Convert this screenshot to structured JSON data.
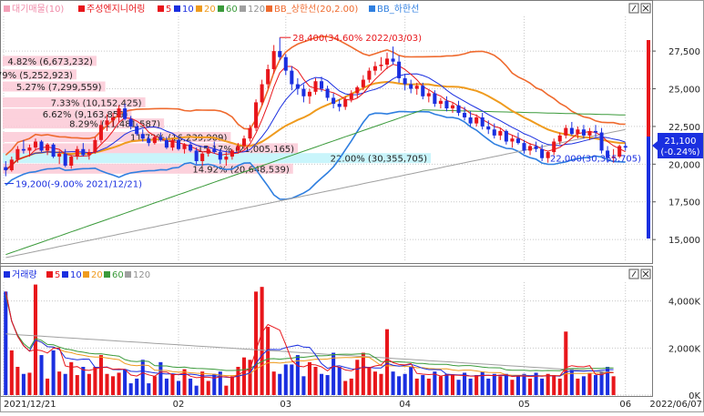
{
  "price_legend": {
    "item_avg_volume": "대기매물(10)",
    "item_name": "주성엔지니어링",
    "ma": [
      "5",
      "10",
      "20",
      "60",
      "120"
    ],
    "item_bb_upper": "BB_상한선(20,2.00)",
    "item_bb_lower": "BB_하한선"
  },
  "volume_legend": {
    "item_volume": "거래량",
    "ma": [
      "5",
      "10",
      "20",
      "60",
      "120"
    ]
  },
  "colors": {
    "up": "#e8161b",
    "down": "#1a2fe0",
    "ma5": "#e8161b",
    "ma10": "#1a2fe0",
    "ma20": "#ef9b1e",
    "ma60": "#3a9a3a",
    "ma120": "#a0a0a0",
    "bb_upper": "#ef6a2e",
    "bb_lower": "#2f7fe0",
    "zone_pink": "#fbc9d6",
    "zone_cyan": "#bff3fa"
  },
  "chart_data": [
    {
      "type": "candlestick",
      "title": "",
      "x_dates": [
        "2021/12/21",
        "2022/06/07"
      ],
      "x_tick_labels": [
        "2021/12/21",
        "02",
        "03",
        "04",
        "05",
        "06",
        "2022/06/07"
      ],
      "ylim": [
        13500,
        29800
      ],
      "y_ticks": [
        "27,500",
        "25,000",
        "22,500",
        "20,000",
        "17,500",
        "15,000"
      ],
      "annotations": {
        "high": "28,400(34.60% 2022/03/03)",
        "low": "19,200(-9.00% 2021/12/21)",
        "last": "22,000(30,355,705)"
      },
      "current_price": "21,100",
      "current_change": "(-0.24%)",
      "volume_profile": [
        {
          "label": "4.82% (6,673,232)",
          "price": 26850,
          "pct": 4.82
        },
        {
          "label": "3.79% (5,252,923)",
          "price": 25950,
          "pct": 3.79
        },
        {
          "label": "5.27% (7,299,559)",
          "price": 25150,
          "pct": 5.27
        },
        {
          "label": "7.33% (10,152,425)",
          "price": 24100,
          "pct": 7.33
        },
        {
          "label": "6.62% (9,163,859)",
          "price": 23350,
          "pct": 6.62
        },
        {
          "label": "8.29% (11,481,587)",
          "price": 22700,
          "pct": 8.29
        },
        {
          "label": "11.72% (16,239,909)",
          "price": 21800,
          "pct": 11.72
        },
        {
          "label": "15.17% (21,005,165)",
          "price": 21050,
          "pct": 15.17
        },
        {
          "label": "22.00% (30,355,705)",
          "price": 20400,
          "pct": 22.0
        },
        {
          "label": "14.92% (20,648,539)",
          "price": 19700,
          "pct": 14.92
        }
      ],
      "candles": [
        [
          19800,
          20200,
          19200,
          19600
        ],
        [
          19600,
          20500,
          19500,
          20300
        ],
        [
          20300,
          21200,
          20100,
          21000
        ],
        [
          21000,
          21600,
          20700,
          20900
        ],
        [
          20900,
          21300,
          20500,
          21100
        ],
        [
          21100,
          21700,
          20900,
          21500
        ],
        [
          21500,
          21600,
          20800,
          20900
        ],
        [
          20900,
          21400,
          20600,
          21300
        ],
        [
          21300,
          21400,
          20400,
          20500
        ],
        [
          20500,
          20900,
          20000,
          20700
        ],
        [
          20700,
          21000,
          19800,
          19900
        ],
        [
          19900,
          20600,
          19700,
          20500
        ],
        [
          20500,
          21200,
          20300,
          21000
        ],
        [
          21000,
          21400,
          20500,
          20600
        ],
        [
          20600,
          21000,
          20300,
          20800
        ],
        [
          20800,
          21800,
          20700,
          21600
        ],
        [
          21600,
          22900,
          21400,
          22600
        ],
        [
          22600,
          23300,
          22200,
          22900
        ],
        [
          22900,
          23400,
          22500,
          23100
        ],
        [
          23100,
          23900,
          22800,
          23700
        ],
        [
          23700,
          24000,
          22900,
          23000
        ],
        [
          23000,
          23200,
          22300,
          22500
        ],
        [
          22500,
          22700,
          21900,
          22000
        ],
        [
          22000,
          22300,
          21500,
          21700
        ],
        [
          21700,
          21900,
          21200,
          21400
        ],
        [
          21400,
          21900,
          21300,
          21800
        ],
        [
          21800,
          22100,
          21500,
          21600
        ],
        [
          21600,
          21800,
          21000,
          21100
        ],
        [
          21100,
          21700,
          20900,
          21600
        ],
        [
          21600,
          21700,
          20900,
          21000
        ],
        [
          21000,
          21400,
          20700,
          21300
        ],
        [
          21300,
          21500,
          20800,
          20900
        ],
        [
          20900,
          21100,
          20000,
          20200
        ],
        [
          20200,
          20800,
          19900,
          20700
        ],
        [
          20700,
          21200,
          20500,
          21000
        ],
        [
          21000,
          21500,
          20700,
          20800
        ],
        [
          20800,
          21000,
          20000,
          20300
        ],
        [
          20300,
          20800,
          19900,
          20500
        ],
        [
          20500,
          21000,
          20300,
          20900
        ],
        [
          20900,
          21400,
          20700,
          21200
        ],
        [
          21200,
          21900,
          21000,
          21700
        ],
        [
          21700,
          22600,
          21500,
          22400
        ],
        [
          22400,
          24300,
          22200,
          24100
        ],
        [
          24100,
          25600,
          23900,
          25300
        ],
        [
          25300,
          26600,
          25000,
          26300
        ],
        [
          26300,
          27900,
          26000,
          27500
        ],
        [
          27500,
          28400,
          26900,
          27100
        ],
        [
          27100,
          27300,
          25900,
          26200
        ],
        [
          26200,
          26500,
          24900,
          25300
        ],
        [
          25300,
          25700,
          24600,
          25000
        ],
        [
          25000,
          25300,
          24100,
          24500
        ],
        [
          24500,
          25000,
          24000,
          24800
        ],
        [
          24800,
          25700,
          24600,
          25500
        ],
        [
          25500,
          25800,
          24800,
          25000
        ],
        [
          25000,
          25200,
          24200,
          24400
        ],
        [
          24400,
          24700,
          23700,
          24000
        ],
        [
          24000,
          24300,
          23500,
          23800
        ],
        [
          23800,
          24500,
          23600,
          24300
        ],
        [
          24300,
          24900,
          24100,
          24700
        ],
        [
          24700,
          25200,
          24400,
          25100
        ],
        [
          25100,
          25900,
          24900,
          25600
        ],
        [
          25600,
          26400,
          25400,
          26200
        ],
        [
          26200,
          26800,
          25900,
          26500
        ],
        [
          26500,
          27100,
          26200,
          26600
        ],
        [
          26600,
          27400,
          26300,
          27000
        ],
        [
          27000,
          27800,
          26600,
          26800
        ],
        [
          26800,
          27200,
          25400,
          25700
        ],
        [
          25700,
          26000,
          24900,
          25300
        ],
        [
          25300,
          25600,
          24700,
          25000
        ],
        [
          25000,
          25400,
          24600,
          25200
        ],
        [
          25200,
          25400,
          24300,
          24500
        ],
        [
          24500,
          24900,
          24100,
          24700
        ],
        [
          24700,
          24900,
          23800,
          24000
        ],
        [
          24000,
          24400,
          23700,
          24200
        ],
        [
          24200,
          24500,
          23500,
          23700
        ],
        [
          23700,
          24100,
          23400,
          23900
        ],
        [
          23900,
          24200,
          23200,
          23400
        ],
        [
          23400,
          23800,
          22900,
          23100
        ],
        [
          23100,
          23500,
          22500,
          22700
        ],
        [
          22700,
          23300,
          22500,
          23100
        ],
        [
          23100,
          23400,
          22300,
          22500
        ],
        [
          22500,
          22900,
          22000,
          22300
        ],
        [
          22300,
          22700,
          21700,
          21900
        ],
        [
          21900,
          22400,
          21600,
          22200
        ],
        [
          22200,
          22300,
          21300,
          21500
        ],
        [
          21500,
          21900,
          21100,
          21700
        ],
        [
          21700,
          22100,
          21300,
          21400
        ],
        [
          21400,
          21600,
          20700,
          20900
        ],
        [
          20900,
          21400,
          20600,
          21200
        ],
        [
          21200,
          21500,
          20800,
          21000
        ],
        [
          21000,
          21300,
          20200,
          20400
        ],
        [
          20400,
          20900,
          20100,
          20800
        ],
        [
          20800,
          21700,
          20600,
          21500
        ],
        [
          21500,
          22100,
          21300,
          21900
        ],
        [
          21900,
          22600,
          21700,
          22400
        ],
        [
          22400,
          22800,
          21900,
          22000
        ],
        [
          22000,
          22500,
          21700,
          22300
        ],
        [
          22300,
          22600,
          21700,
          21900
        ],
        [
          21900,
          22400,
          21600,
          22200
        ],
        [
          22200,
          22600,
          21800,
          22100
        ],
        [
          22100,
          22400,
          20700,
          20900
        ],
        [
          20900,
          21200,
          20100,
          20400
        ],
        [
          20400,
          21000,
          20100,
          20500
        ],
        [
          20500,
          21300,
          20400,
          21200
        ],
        [
          21200,
          21400,
          20900,
          21100
        ]
      ]
    },
    {
      "type": "bar",
      "title": "",
      "ylim": [
        0,
        4800000
      ],
      "y_ticks": [
        "4,000K",
        "2,000K",
        "0K"
      ],
      "values": [
        4400000,
        1900000,
        1200000,
        900000,
        950000,
        4700000,
        1700000,
        700000,
        1900000,
        1000000,
        900000,
        1400000,
        850000,
        1200000,
        900000,
        1200000,
        1700000,
        900000,
        800000,
        950000,
        1100000,
        500000,
        700000,
        1500000,
        500000,
        800000,
        1400000,
        700000,
        900000,
        600000,
        1100000,
        700000,
        400000,
        1000000,
        600000,
        900000,
        1000000,
        400000,
        800000,
        1200000,
        1600000,
        1500000,
        4400000,
        4600000,
        2900000,
        1000000,
        900000,
        1300000,
        1300000,
        1700000,
        800000,
        1400000,
        1200000,
        900000,
        850000,
        1800000,
        1200000,
        600000,
        700000,
        1500000,
        1800000,
        1200000,
        1000000,
        900000,
        2800000,
        1000000,
        800000,
        900000,
        1200000,
        700000,
        850000,
        700000,
        1000000,
        800000,
        900000,
        850000,
        650000,
        950000,
        700000,
        850000,
        1000000,
        700000,
        900000,
        800000,
        900000,
        650000,
        800000,
        900000,
        700000,
        950000,
        700000,
        900000,
        850000,
        700000,
        2700000,
        1100000,
        700000,
        800000,
        950000,
        850000,
        1000000,
        1200000,
        800000
      ]
    }
  ]
}
